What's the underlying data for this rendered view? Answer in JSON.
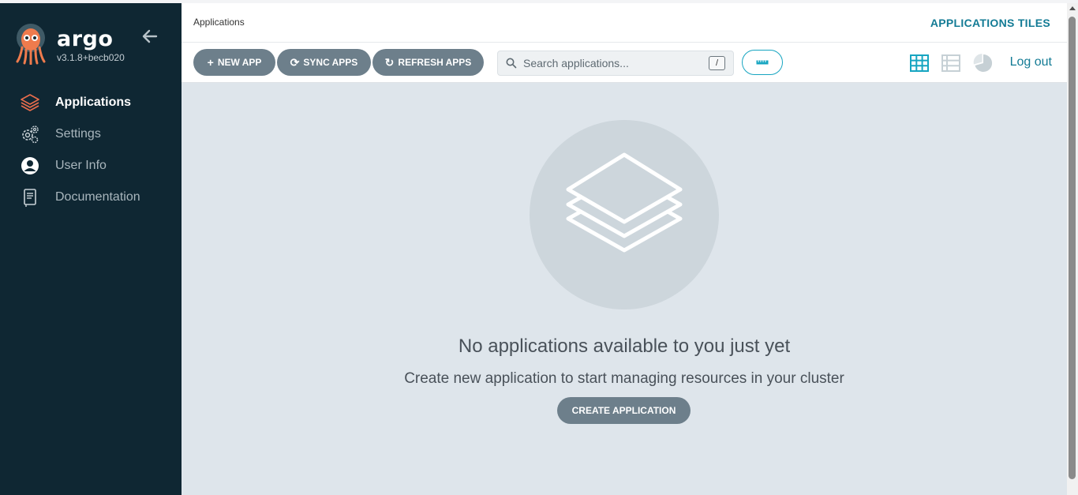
{
  "app": {
    "name": "argo",
    "version": "v3.1.8+becb020"
  },
  "sidebar": {
    "items": [
      {
        "label": "Applications",
        "icon": "layers-icon",
        "active": true
      },
      {
        "label": "Settings",
        "icon": "gears-icon",
        "active": false
      },
      {
        "label": "User Info",
        "icon": "user-circle-icon",
        "active": false
      },
      {
        "label": "Documentation",
        "icon": "book-icon",
        "active": false
      }
    ]
  },
  "header": {
    "breadcrumb": "Applications",
    "title": "APPLICATIONS TILES"
  },
  "toolbar": {
    "new_app": "NEW APP",
    "sync_apps": "SYNC APPS",
    "refresh_apps": "REFRESH APPS",
    "search_placeholder": "Search applications...",
    "search_shortcut": "/",
    "views": [
      "tiles-view-icon",
      "list-view-icon",
      "summary-view-icon"
    ],
    "logout": "Log out"
  },
  "empty_state": {
    "title": "No applications available to you just yet",
    "subtitle": "Create new application to start managing resources in your cluster",
    "button": "CREATE APPLICATION"
  },
  "colors": {
    "sidebar_bg": "#0f2733",
    "accent": "#137b95",
    "accent_bright": "#16a5c1",
    "button_bg": "#6d7f8b",
    "main_bg": "#dee5eb",
    "active_icon": "#e96d4c"
  }
}
